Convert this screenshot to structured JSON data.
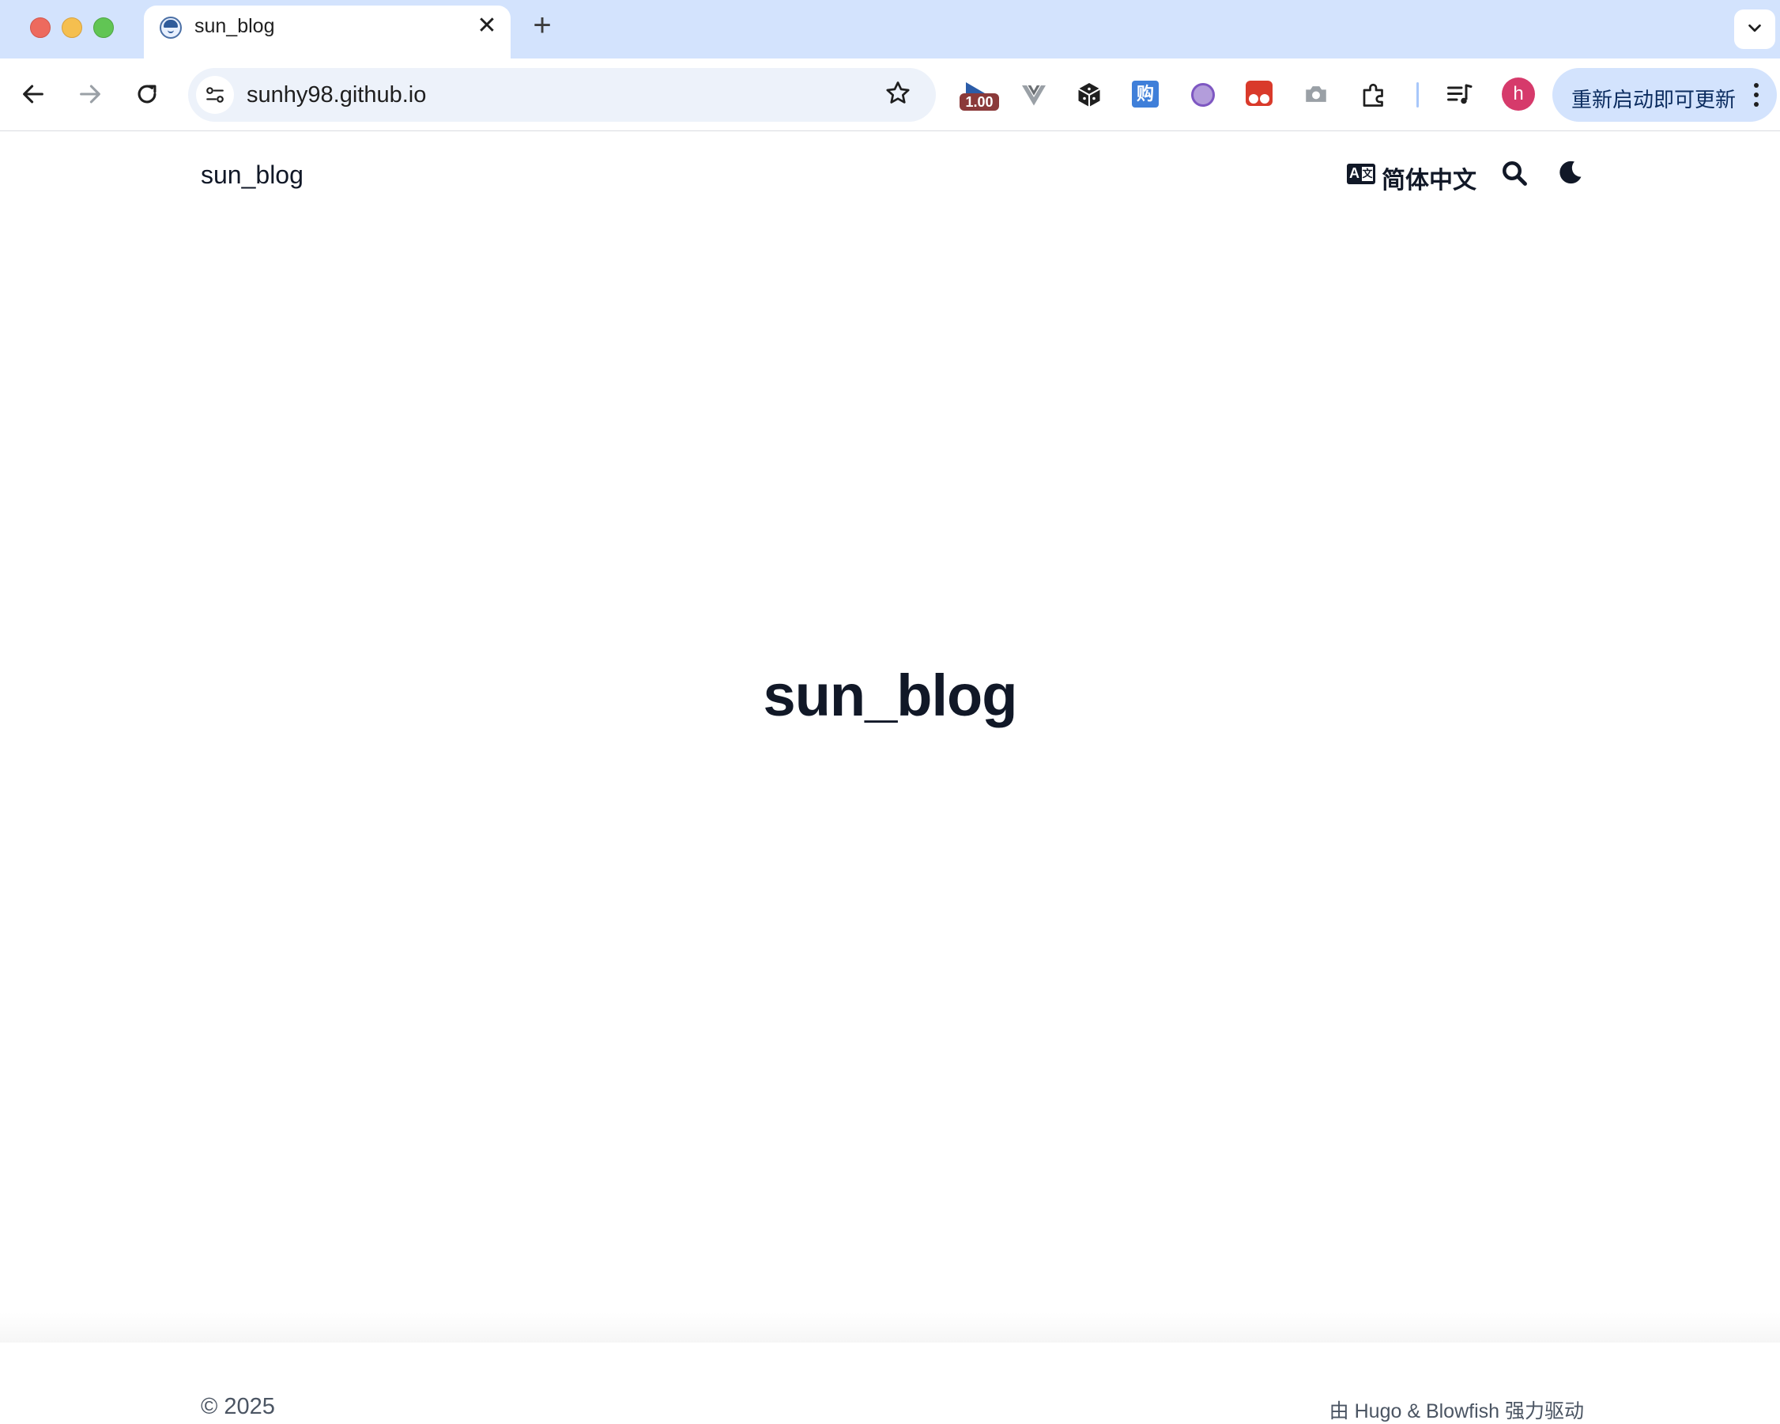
{
  "browser": {
    "tab_title": "sun_blog",
    "tab_close_glyph": "✕",
    "new_tab_glyph": "+",
    "url": "sunhy98.github.io",
    "extensions": {
      "speed_badge": "1.00",
      "translate_glyph": "购"
    },
    "profile_initial": "h",
    "update_button_label": "重新启动即可更新"
  },
  "site": {
    "logo_text": "sun_blog",
    "language_label": "简体中文",
    "language_icon_a": "A",
    "language_icon_z": "文",
    "hero_title": "sun_blog",
    "footer_copyright": "© 2025",
    "footer_powered": "由 Hugo & Blowfish 强力驱动"
  },
  "colors": {
    "tabstrip": "#d3e3fd",
    "omnibox": "#edf2fa",
    "text_dark": "#111827",
    "text_muted": "#4b5563",
    "avatar": "#d63a6b"
  }
}
